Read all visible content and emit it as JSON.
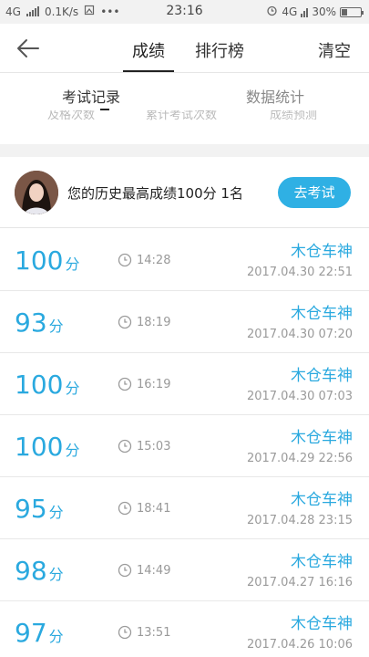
{
  "status_bar": {
    "network_left": "4G",
    "speed": "0.1K/s",
    "time": "23:16",
    "network_right": "4G",
    "battery": "30%",
    "battery_level": 0.3
  },
  "nav": {
    "tab_scores": "成绩",
    "tab_ranking": "排行榜",
    "clear": "清空"
  },
  "subtabs": {
    "records": "考试记录",
    "stats": "数据统计"
  },
  "cut_stats": [
    "及格次数",
    "累计考试次数",
    "成绩预测"
  ],
  "best": {
    "text": "您的历史最高成绩100分 1名",
    "go_button": "去考试"
  },
  "records": [
    {
      "score": "100",
      "unit": "分",
      "duration": "14:28",
      "name": "木仓车神",
      "date": "2017.04.30  22:51"
    },
    {
      "score": "93",
      "unit": "分",
      "duration": "18:19",
      "name": "木仓车神",
      "date": "2017.04.30  07:20"
    },
    {
      "score": "100",
      "unit": "分",
      "duration": "16:19",
      "name": "木仓车神",
      "date": "2017.04.30  07:03"
    },
    {
      "score": "100",
      "unit": "分",
      "duration": "15:03",
      "name": "木仓车神",
      "date": "2017.04.29  22:56"
    },
    {
      "score": "95",
      "unit": "分",
      "duration": "18:41",
      "name": "木仓车神",
      "date": "2017.04.28  23:15"
    },
    {
      "score": "98",
      "unit": "分",
      "duration": "14:49",
      "name": "木仓车神",
      "date": "2017.04.27  16:16"
    },
    {
      "score": "97",
      "unit": "分",
      "duration": "13:51",
      "name": "木仓车神",
      "date": "2017.04.26  10:06"
    }
  ],
  "colors": {
    "accent": "#2aa9df",
    "button": "#2fb0e4"
  }
}
